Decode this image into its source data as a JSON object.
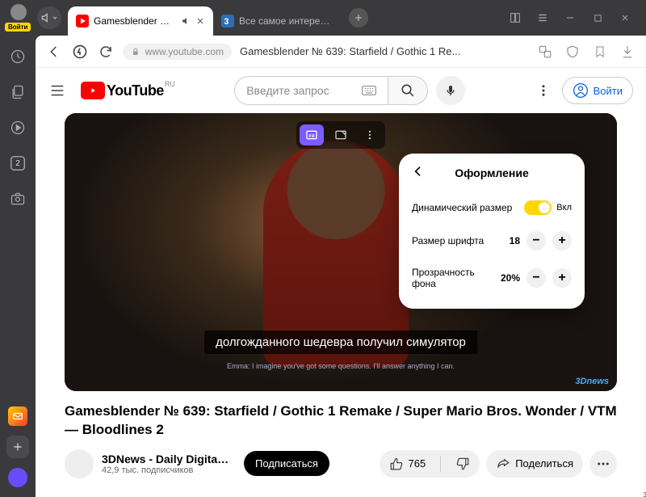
{
  "browser": {
    "login_chip": "Войти",
    "tabs": [
      {
        "title": "Gamesblender № 63",
        "active": true,
        "has_audio": true
      },
      {
        "title": "Все самое интересное и...",
        "active": false
      }
    ],
    "address_url": "www.youtube.com",
    "address_title": "Gamesblender № 639: Starfield / Gothic 1 Re...",
    "sidebar_badge": "2"
  },
  "youtube": {
    "logo_text": "YouTube",
    "logo_region": "RU",
    "search_placeholder": "Введите запрос",
    "signin_label": "Войти"
  },
  "popup": {
    "title": "Оформление",
    "rows": {
      "dynamic": {
        "label": "Динамический размер",
        "state_label": "Вкл",
        "on": true
      },
      "font_size": {
        "label": "Размер шрифта",
        "value": "18"
      },
      "bg_opacity": {
        "label": "Прозрачность фона",
        "value": "20%"
      }
    }
  },
  "captions": {
    "main": "долгожданного шедевра получил симулятор",
    "secondary": "Emma: I imagine you've got some questions. I'll answer anything I can.",
    "watermark": "3Dnews"
  },
  "video": {
    "title": "Gamesblender № 639: Starfield / Gothic 1 Remake / Super Mario Bros. Wonder / VTM — Bloodlines 2",
    "channel_name": "3DNews - Daily Digital Di...",
    "subscribers": "42,9 тыс. подписчиков",
    "subscribe_label": "Подписаться",
    "likes": "765",
    "share_label": "Поделиться"
  }
}
